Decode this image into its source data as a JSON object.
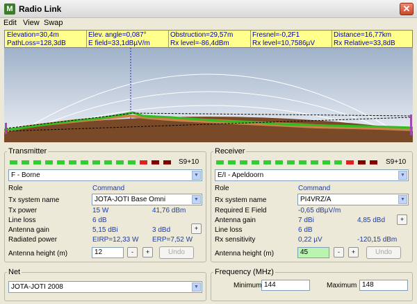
{
  "window": {
    "title": "Radio Link"
  },
  "menu": [
    "Edit",
    "View",
    "Swap"
  ],
  "info": {
    "row1": [
      "Elevation=30,4m",
      "Elev. angle=0,087°",
      "Obstruction=29,57m",
      "Fresnel=-0,2F1",
      "Distance=16,77km"
    ],
    "row2": [
      "PathLoss=128,3dB",
      "E field=33,1dBµV/m",
      "Rx level=-86,4dBm",
      "Rx level=10,7586µV",
      "Rx Relative=33,8dB"
    ]
  },
  "transmitter": {
    "title": "Transmitter",
    "s_label": "S9+10",
    "site": "F - Borne",
    "role_label": "Role",
    "role_value": "Command",
    "system_label": "Tx system name",
    "system_value": "JOTA-JOTI Base Omni",
    "power_label": "Tx power",
    "power_w": "15 W",
    "power_dbm": "41,76 dBm",
    "line_loss_label": "Line loss",
    "line_loss_value": "6 dB",
    "gain_label": "Antenna gain",
    "gain_dbi": "5,15 dBi",
    "gain_dbd": "3 dBd",
    "radiated_label": "Radiated power",
    "eirp": "EIRP=12,33 W",
    "erp": "ERP=7,52 W",
    "height_label": "Antenna height (m)",
    "height_value": "12",
    "undo": "Undo"
  },
  "receiver": {
    "title": "Receiver",
    "s_label": "S9+10",
    "site": "E/I - Apeldoorn",
    "role_label": "Role",
    "role_value": "Command",
    "system_label": "Rx system name",
    "system_value": "PI4VRZ/A",
    "req_label": "Required E Field",
    "req_value": "-0,65 dBµV/m",
    "gain_label": "Antenna gain",
    "gain_dbi": "7 dBi",
    "gain_dbd": "4,85 dBd",
    "line_loss_label": "Line loss",
    "line_loss_value": "6 dB",
    "sens_label": "Rx sensitivity",
    "sens_uv": "0,22 µV",
    "sens_dbm": "-120,15 dBm",
    "height_label": "Antenna height (m)",
    "height_value": "45",
    "undo": "Undo"
  },
  "net": {
    "title": "Net",
    "value": "JOTA-JOTI 2008"
  },
  "frequency": {
    "title": "Frequency (MHz)",
    "min_label": "Minimum",
    "min_value": "144",
    "max_label": "Maximum",
    "max_value": "148"
  },
  "meter_colors": {
    "green": "#33cc33",
    "red": "#e02020",
    "darkred": "#800000"
  },
  "meter_segments": [
    "green",
    "green",
    "green",
    "green",
    "green",
    "green",
    "green",
    "green",
    "green",
    "green",
    "green",
    "red",
    "darkred",
    "darkred"
  ],
  "plus_symbol": "+",
  "minus_symbol": "-"
}
